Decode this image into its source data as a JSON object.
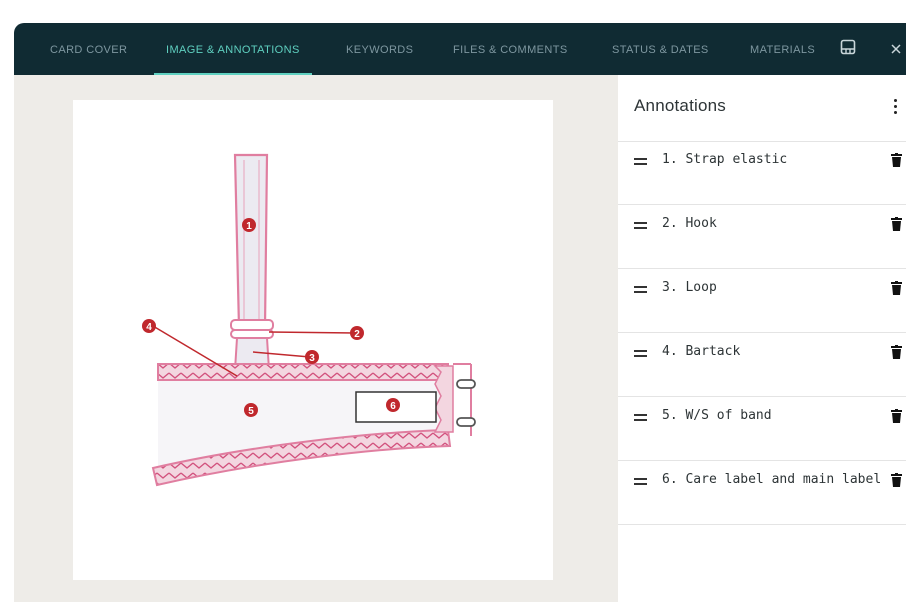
{
  "tabs": [
    {
      "label": "CARD COVER",
      "active": false
    },
    {
      "label": "IMAGE & ANNOTATIONS",
      "active": true
    },
    {
      "label": "KEYWORDS",
      "active": false
    },
    {
      "label": "FILES & COMMENTS",
      "active": false
    },
    {
      "label": "STATUS & DATES",
      "active": false
    },
    {
      "label": "MATERIALS",
      "active": false
    }
  ],
  "topbar_icons": [
    "panel-layout-icon",
    "close-icon"
  ],
  "panel": {
    "title": "Annotations",
    "menu_icon": "more-vertical-icon"
  },
  "annotations": [
    {
      "number": "1",
      "text": "1. Strap elastic"
    },
    {
      "number": "2",
      "text": "2. Hook"
    },
    {
      "number": "3",
      "text": "3. Loop"
    },
    {
      "number": "4",
      "text": "4. Bartack"
    },
    {
      "number": "5",
      "text": "5. W/S of band"
    },
    {
      "number": "6",
      "text": "6. Care label and main label"
    }
  ],
  "icons": {
    "drag": "drag-handle-icon",
    "delete": "trash-icon"
  },
  "colors": {
    "topbar": "#102b33",
    "active_tab": "#5fd0c0",
    "inactive_tab": "#7e97a0",
    "marker": "#c0282d",
    "stitching": "#e07ea0",
    "canvas_bg": "#eeece8"
  }
}
